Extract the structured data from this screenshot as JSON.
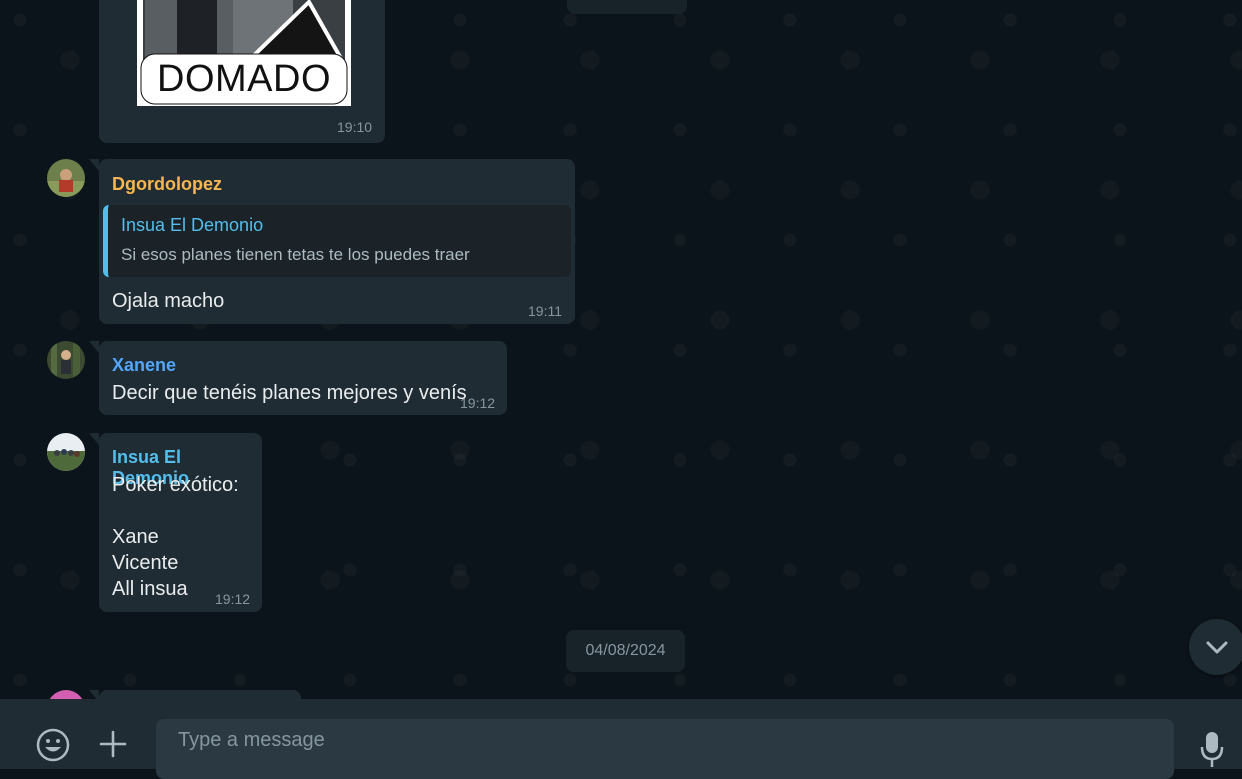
{
  "messages": {
    "sticker": {
      "caption": "DOMADO",
      "time": "19:10"
    },
    "msg1": {
      "sender": "Dgordolopez",
      "sender_color": "#f7b64f",
      "quote_author": "Insua El Demonio",
      "quote_text": "Si esos planes tienen tetas te los puedes traer",
      "text": "Ojala macho",
      "time": "19:11"
    },
    "msg2": {
      "sender": "Xanene",
      "sender_color": "#53a6fd",
      "text": "Decir que tenéis planes mejores y venís",
      "time": "19:12"
    },
    "msg3": {
      "sender": "Insua El Demonio",
      "sender_color": "#53bdeb",
      "text": "Poker exótico:\n\nXane\nVicente\nAll insua",
      "time": "19:12"
    }
  },
  "date_separator": "04/08/2024",
  "composer": {
    "placeholder": "Type a message"
  },
  "icons": {
    "emoji": "emoji-icon",
    "attach": "plus-icon",
    "mic": "microphone-icon",
    "scroll": "chevron-down-icon"
  }
}
